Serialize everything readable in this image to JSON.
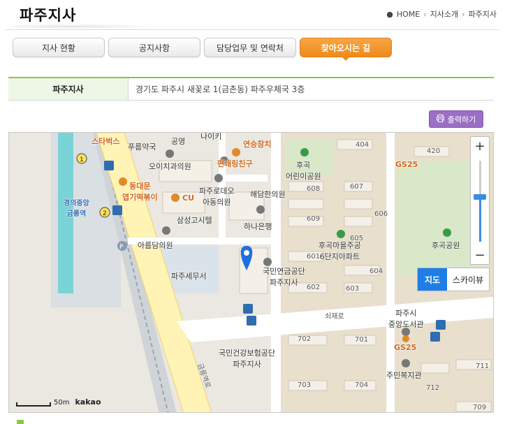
{
  "header": {
    "title": "파주지사",
    "breadcrumb": [
      "HOME",
      "지사소개",
      "파주지사"
    ]
  },
  "tabs": [
    {
      "label": "지사 현황",
      "active": false
    },
    {
      "label": "공지사항",
      "active": false
    },
    {
      "label": "담당업무 및 연락처",
      "active": false
    },
    {
      "label": "찾아오시는 길",
      "active": true
    }
  ],
  "info": {
    "label": "파주지사",
    "address": "경기도 파주시 새꽃로 1(금촌동) 파주우체국 3층"
  },
  "print_label": "출력하기",
  "map": {
    "labels": {
      "starbucks": "스타벅스",
      "pureum_pharmacy": "푸름약국",
      "gongyeong": "공영",
      "nike": "나이키",
      "yeonseung": "연승참치",
      "dental": "오이치과의원",
      "conv_friend": "편쇄링친구",
      "dongdaemun": "동대문\n엽기떡볶이",
      "cu": "CU",
      "rodeo_clinic": "파주로데오\n아동의원",
      "haedal": "해담한의원",
      "samsung_hotel": "삼성고시텔",
      "hana_bank": "하나은행",
      "areumdam": "아름담의원",
      "tax_office": "파주세무서",
      "nps": "국민연금공단\n파주지사",
      "nhis": "국민건강보험공단\n파주지사",
      "station": "경의중앙\n금릉역",
      "hugok_kinder": "후곡\n어린이공원",
      "hugok_apt": "후곡마을주공\n6단지아파트",
      "hugok_park": "후곡공원",
      "gs25_top": "GS25",
      "gs25_bottom": "GS25",
      "library": "파주시\n중앙도서관",
      "welfare": "주민복지관",
      "road_saejae": "쇠재로",
      "road_geumneung": "금릉역로",
      "b404": "404",
      "b420": "420",
      "b608": "608",
      "b607": "607",
      "b609": "609",
      "b606": "606",
      "b605": "605",
      "b601": "601",
      "b604": "604",
      "b602": "602",
      "b603": "603",
      "b702": "702",
      "b701": "701",
      "b703": "703",
      "b704": "704",
      "b711": "711",
      "b712": "712",
      "b709": "709"
    },
    "map_type": {
      "map": "지도",
      "skyview": "스카이뷰"
    },
    "zoom_level": 0.55,
    "scale_text": "50m",
    "logo": "kakao"
  }
}
